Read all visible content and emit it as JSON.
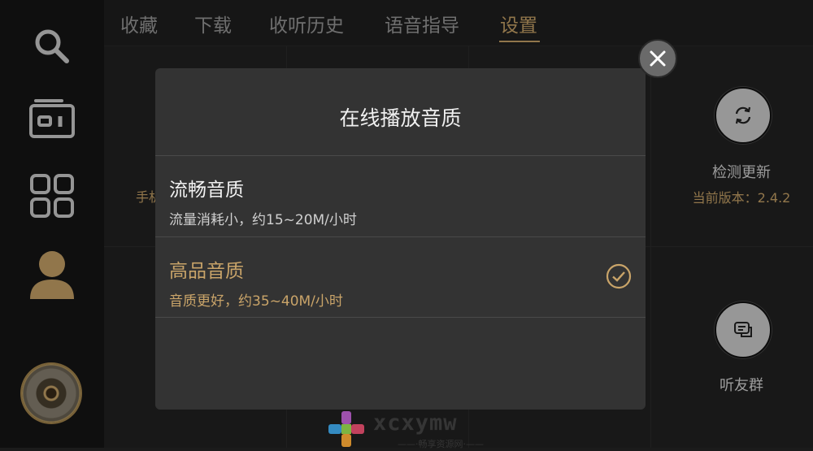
{
  "tabs": [
    {
      "label": "收藏"
    },
    {
      "label": "下载"
    },
    {
      "label": "收听历史"
    },
    {
      "label": "语音指导"
    },
    {
      "label": "设置",
      "active": true
    }
  ],
  "sidebar": {
    "icons": [
      "search-icon",
      "radio-icon",
      "grid-icon",
      "user-icon",
      "album-cover"
    ]
  },
  "settings": {
    "check_update": {
      "label": "检测更新",
      "version": "当前版本：2.4.2"
    },
    "listen_group": {
      "label": "听友群"
    },
    "peek_text": "手机"
  },
  "dialog": {
    "title": "在线播放音质",
    "options": [
      {
        "title": "流畅音质",
        "desc": "流量消耗小，约15~20M/小时",
        "selected": false
      },
      {
        "title": "高品音质",
        "desc": "音质更好，约35~40M/小时",
        "selected": true
      }
    ]
  },
  "watermark": {
    "text": "xcxymw",
    "sub": "——·畅享资源网·——"
  },
  "colors": {
    "accent": "#c9a469",
    "dialog_bg": "#333333",
    "background": "#1b1b1b"
  }
}
